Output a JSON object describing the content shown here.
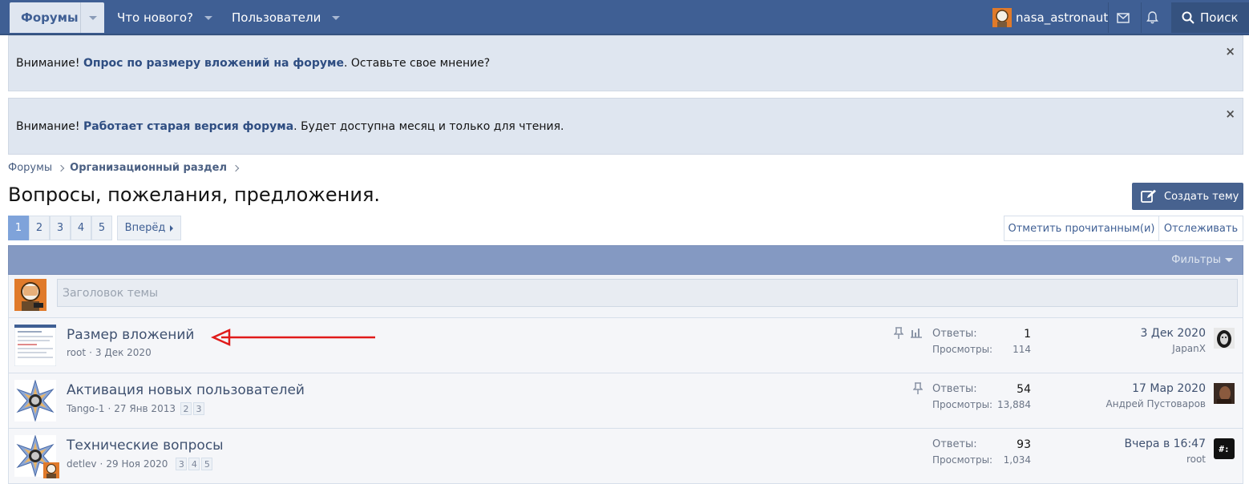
{
  "nav": {
    "forums_label": "Форумы",
    "whats_new_label": "Что нового?",
    "users_label": "Пользователи",
    "username": "nasa_astronaut",
    "search_label": "Поиск",
    "icons": {
      "inbox": "envelope-icon",
      "alerts": "bell-icon",
      "search": "search-icon"
    }
  },
  "notices": [
    {
      "prefix": "Внимание! ",
      "link": "Опрос по размеру вложений на форуме",
      "suffix": ". Оставьте свое мнение?"
    },
    {
      "prefix": "Внимание! ",
      "link": "Работает старая версия форума",
      "suffix": ". Будет доступна месяц и только для чтения."
    }
  ],
  "notice_close": "×",
  "breadcrumb": {
    "root": "Форумы",
    "section": "Организационный раздел"
  },
  "page_title": "Вопросы, пожелания, предложения.",
  "create_thread_label": "Создать тему",
  "pagination": {
    "pages": [
      "1",
      "2",
      "3",
      "4",
      "5"
    ],
    "current": "1",
    "next_label": "Вперёд"
  },
  "actions": {
    "mark_read": "Отметить прочитанным(и)",
    "watch": "Отслеживать"
  },
  "filters_label": "Фильтры",
  "quick_thread": {
    "placeholder": "Заголовок темы"
  },
  "threads": [
    {
      "title": "Размер вложений",
      "author": "root",
      "date": "3 Дек 2020",
      "pages": [],
      "replies_label": "Ответы:",
      "replies": "1",
      "views_label": "Просмотры:",
      "views": "114",
      "last_date": "3 Дек 2020",
      "last_user": "JapanX",
      "icons": [
        "pin-icon",
        "poll-icon"
      ]
    },
    {
      "title": "Активация новых пользователей",
      "author": "Tango-1",
      "date": "27 Янв 2013",
      "pages": [
        "2",
        "3"
      ],
      "replies_label": "Ответы:",
      "replies": "54",
      "views_label": "Просмотры:",
      "views": "13,884",
      "last_date": "17 Мар 2020",
      "last_user": "Андрей Пустоваров",
      "icons": [
        "pin-icon"
      ]
    },
    {
      "title": "Технические вопросы",
      "author": "detlev",
      "date": "29 Ноя 2020",
      "pages": [
        "3",
        "4",
        "5"
      ],
      "replies_label": "Ответы:",
      "replies": "93",
      "views_label": "Просмотры:",
      "views": "1,034",
      "last_date": "Вчера в 16:47",
      "last_user": "root",
      "icons": []
    }
  ],
  "meta_sep": "·",
  "colors": {
    "nav": "#3f5f94",
    "accent": "#47628f",
    "annotation_arrow": "#e01b1b"
  }
}
